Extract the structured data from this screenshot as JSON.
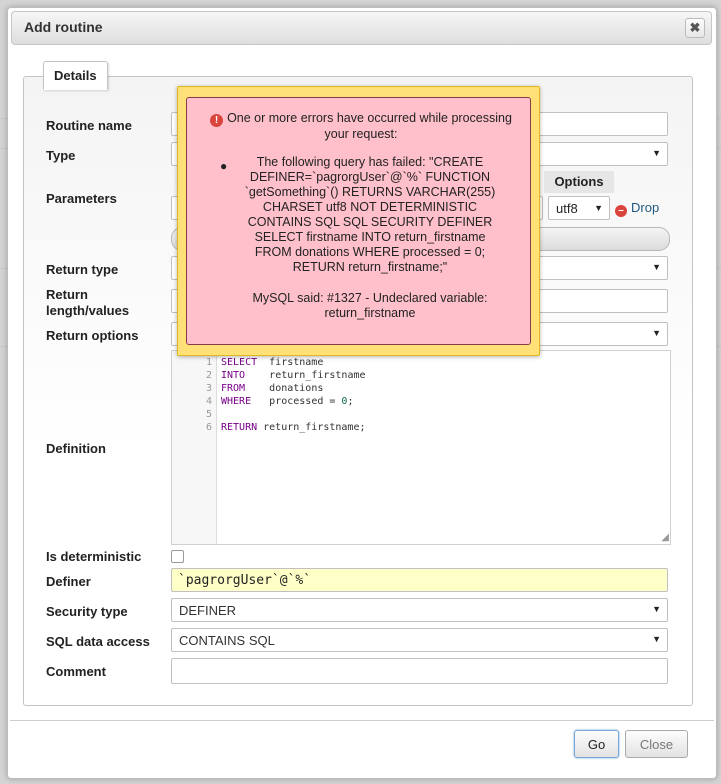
{
  "dialog": {
    "title": "Add routine",
    "close_glyph": "✖"
  },
  "tab": {
    "label": "Details"
  },
  "labels": {
    "routine_name": "Routine name",
    "type": "Type",
    "parameters": "Parameters",
    "return_type": "Return type",
    "return_length_line1": "Return",
    "return_length_line2": "length/values",
    "return_options": "Return options",
    "definition": "Definition",
    "is_deterministic": "Is deterministic",
    "definer": "Definer",
    "security_type": "Security type",
    "sql_data_access": "SQL data access",
    "comment": "Comment"
  },
  "parameters": {
    "options_header": "Options",
    "charset_value": "utf8",
    "drop_label": "Drop"
  },
  "fields": {
    "definer_value": "`pagrorgUser`@`%`",
    "security_type_value": "DEFINER",
    "sql_data_access_value": "CONTAINS SQL",
    "is_deterministic_checked": false
  },
  "definition": {
    "lines": [
      {
        "n": "1",
        "kw": "SELECT",
        "rest": "  firstname"
      },
      {
        "n": "2",
        "kw": "INTO",
        "rest": "    return_firstname"
      },
      {
        "n": "3",
        "kw": "FROM",
        "rest": "    donations"
      },
      {
        "n": "4",
        "kw": "WHERE",
        "rest": "   processed = ",
        "num": "0",
        "tail": ";"
      },
      {
        "n": "5",
        "kw": "",
        "rest": ""
      },
      {
        "n": "6",
        "kw": "RETURN",
        "rest": " return_firstname;"
      }
    ]
  },
  "error": {
    "heading": "One or more errors have occurred while processing your request:",
    "query": "The following query has failed: \"CREATE DEFINER=`pagrorgUser`@`%` FUNCTION `getSomething`() RETURNS VARCHAR(255) CHARSET utf8 NOT DETERMINISTIC CONTAINS SQL SQL SECURITY DEFINER SELECT firstname INTO return_firstname FROM donations WHERE processed = 0; RETURN return_firstname;\"",
    "mysql_said": "MySQL said: #1327 - Undeclared variable: return_firstname"
  },
  "buttons": {
    "go": "Go",
    "close": "Close"
  },
  "colors": {
    "error_bg": "#ffc0cb",
    "error_frame": "#ffe178",
    "definer_bg": "#ffffc8",
    "drop_icon": "#d9453c"
  }
}
